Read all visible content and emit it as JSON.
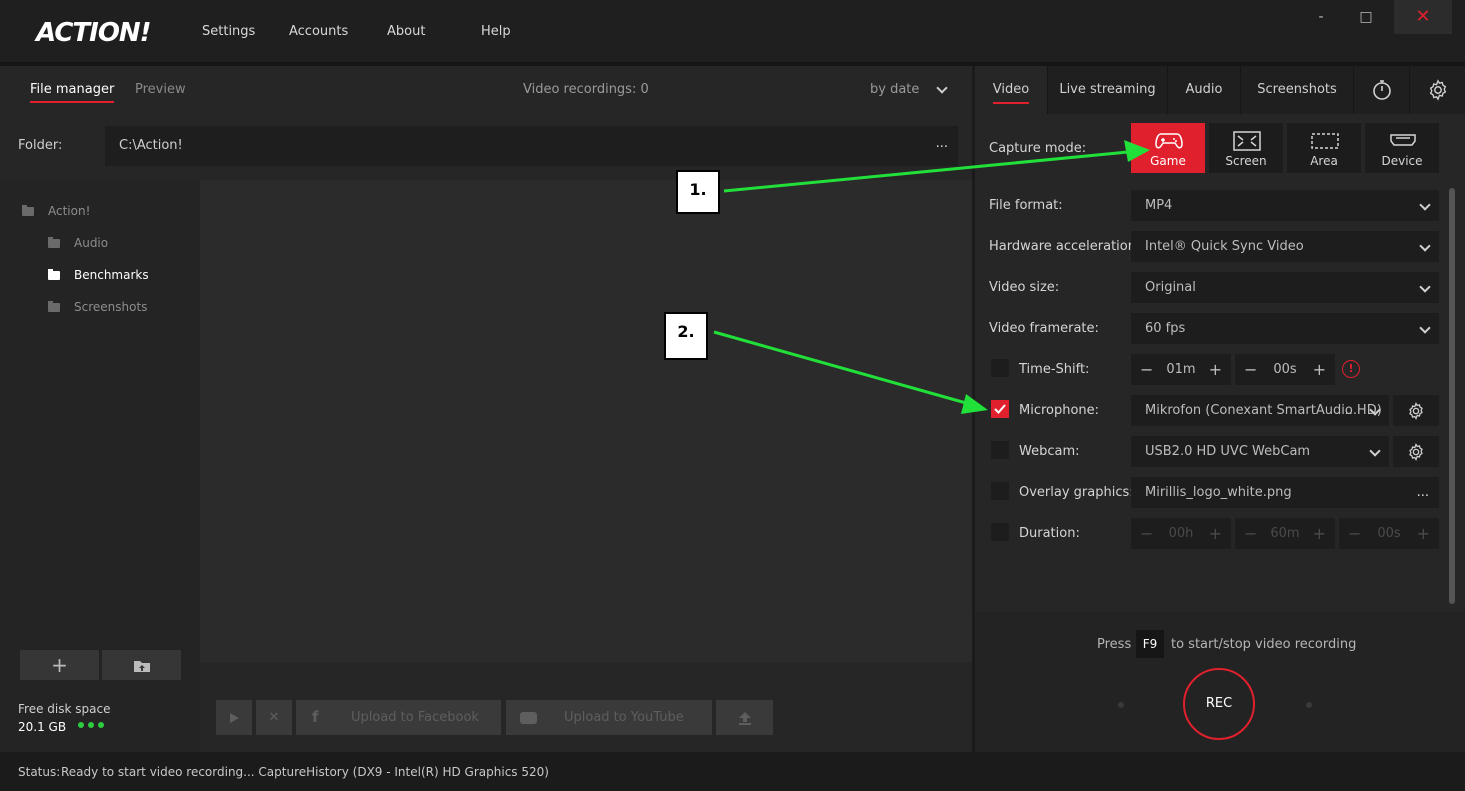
{
  "app": {
    "logo": "ACTION!"
  },
  "menu": {
    "settings": "Settings",
    "accounts": "Accounts",
    "about": "About",
    "help": "Help"
  },
  "window": {
    "minimize": "-",
    "maximize": "□",
    "close": "✕"
  },
  "left": {
    "tabs": {
      "file_manager": "File manager",
      "preview": "Preview"
    },
    "recordings_count": "Video recordings: 0",
    "sort": "by date",
    "folder_label": "Folder:",
    "folder_path": "C:\\Action!",
    "folder_more": "...",
    "tree": {
      "root": "Action!",
      "items": [
        "Audio",
        "Benchmarks",
        "Screenshots"
      ]
    },
    "free_disk_label": "Free disk space",
    "free_disk_value": "20.1 GB",
    "upload_facebook": "Upload to Facebook",
    "upload_youtube": "Upload to YouTube"
  },
  "right": {
    "tabs": {
      "video": "Video",
      "live": "Live streaming",
      "audio": "Audio",
      "screenshots": "Screenshots"
    },
    "capture_label": "Capture mode:",
    "modes": {
      "game": "Game",
      "screen": "Screen",
      "area": "Area",
      "device": "Device"
    },
    "rows": {
      "file_format": {
        "label": "File format:",
        "value": "MP4"
      },
      "hw_accel": {
        "label": "Hardware acceleration:",
        "value": "Intel® Quick Sync Video"
      },
      "video_size": {
        "label": "Video size:",
        "value": "Original"
      },
      "framerate": {
        "label": "Video framerate:",
        "value": "60 fps"
      },
      "timeshift": {
        "label": "Time-Shift:",
        "minutes": "01m",
        "seconds": "00s"
      },
      "microphone": {
        "label": "Microphone:",
        "value": "Mikrofon (Conexant SmartAudio HD)",
        "more": "..."
      },
      "webcam": {
        "label": "Webcam:",
        "value": "USB2.0 HD UVC WebCam"
      },
      "overlay": {
        "label": "Overlay graphics:",
        "value": "Mirillis_logo_white.png",
        "more": "..."
      },
      "duration": {
        "label": "Duration:",
        "hours": "00h",
        "minutes": "60m",
        "seconds": "00s"
      }
    },
    "hint_press": "Press",
    "hint_key": "F9",
    "hint_text": "to start/stop video recording",
    "rec": "REC"
  },
  "status": {
    "label": "Status:",
    "text": "Ready to start video recording... CaptureHistory (DX9 - Intel(R) HD Graphics 520)"
  },
  "callouts": {
    "one": "1.",
    "two": "2."
  },
  "colors": {
    "accent": "#e0202c",
    "arrow": "#22e03a"
  }
}
